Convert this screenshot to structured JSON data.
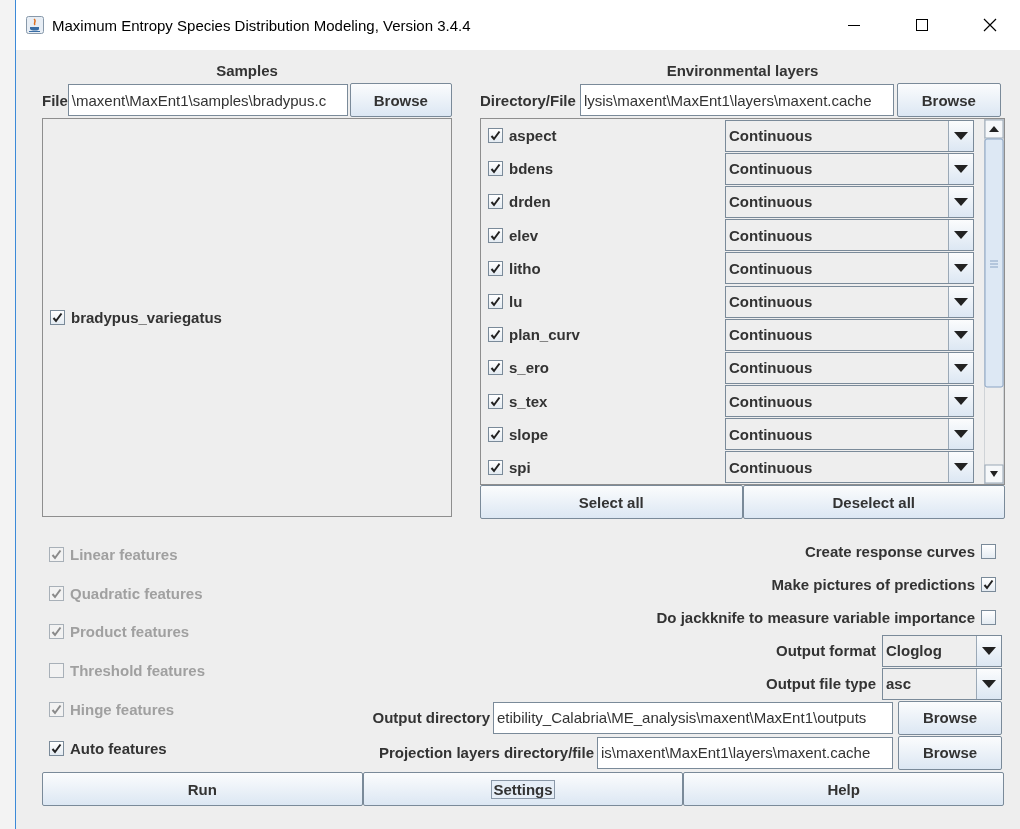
{
  "window": {
    "title": "Maximum Entropy Species Distribution Modeling, Version 3.4.4"
  },
  "samples": {
    "heading": "Samples",
    "file_label": "File",
    "file_value": "\\maxent\\MaxEnt1\\samples\\bradypus.c",
    "browse": "Browse",
    "species": [
      {
        "name": "bradypus_variegatus",
        "checked": true
      }
    ]
  },
  "environment": {
    "heading": "Environmental layers",
    "file_label": "Directory/File",
    "file_value": "lysis\\maxent\\MaxEnt1\\layers\\maxent.cache",
    "browse": "Browse",
    "layers": [
      {
        "name": "aspect",
        "checked": true,
        "type": "Continuous"
      },
      {
        "name": "bdens",
        "checked": true,
        "type": "Continuous"
      },
      {
        "name": "drden",
        "checked": true,
        "type": "Continuous"
      },
      {
        "name": "elev",
        "checked": true,
        "type": "Continuous"
      },
      {
        "name": "litho",
        "checked": true,
        "type": "Continuous"
      },
      {
        "name": "lu",
        "checked": true,
        "type": "Continuous"
      },
      {
        "name": "plan_curv",
        "checked": true,
        "type": "Continuous"
      },
      {
        "name": "s_ero",
        "checked": true,
        "type": "Continuous"
      },
      {
        "name": "s_tex",
        "checked": true,
        "type": "Continuous"
      },
      {
        "name": "slope",
        "checked": true,
        "type": "Continuous"
      },
      {
        "name": "spi",
        "checked": true,
        "type": "Continuous"
      }
    ],
    "select_all": "Select all",
    "deselect_all": "Deselect all"
  },
  "features": [
    {
      "label": "Linear features",
      "checked": true,
      "disabled": true
    },
    {
      "label": "Quadratic features",
      "checked": true,
      "disabled": true
    },
    {
      "label": "Product features",
      "checked": true,
      "disabled": true
    },
    {
      "label": "Threshold features",
      "checked": false,
      "disabled": true
    },
    {
      "label": "Hinge features",
      "checked": true,
      "disabled": true
    },
    {
      "label": "Auto features",
      "checked": true,
      "disabled": false
    }
  ],
  "options": [
    {
      "label": "Create response curves",
      "checked": false
    },
    {
      "label": "Make pictures of predictions",
      "checked": true
    },
    {
      "label": "Do jackknife to measure variable importance",
      "checked": false
    }
  ],
  "output_format": {
    "label": "Output format",
    "value": "Cloglog"
  },
  "output_file_type": {
    "label": "Output file type",
    "value": "asc"
  },
  "output_directory": {
    "label": "Output directory",
    "value": "etibility_Calabria\\ME_analysis\\maxent\\MaxEnt1\\outputs",
    "browse": "Browse"
  },
  "projection_layers": {
    "label": "Projection layers directory/file",
    "value": "is\\maxent\\MaxEnt1\\layers\\maxent.cache",
    "browse": "Browse"
  },
  "buttons": [
    {
      "label": "Run",
      "focused": false
    },
    {
      "label": "Settings",
      "focused": true
    },
    {
      "label": "Help",
      "focused": false
    }
  ]
}
